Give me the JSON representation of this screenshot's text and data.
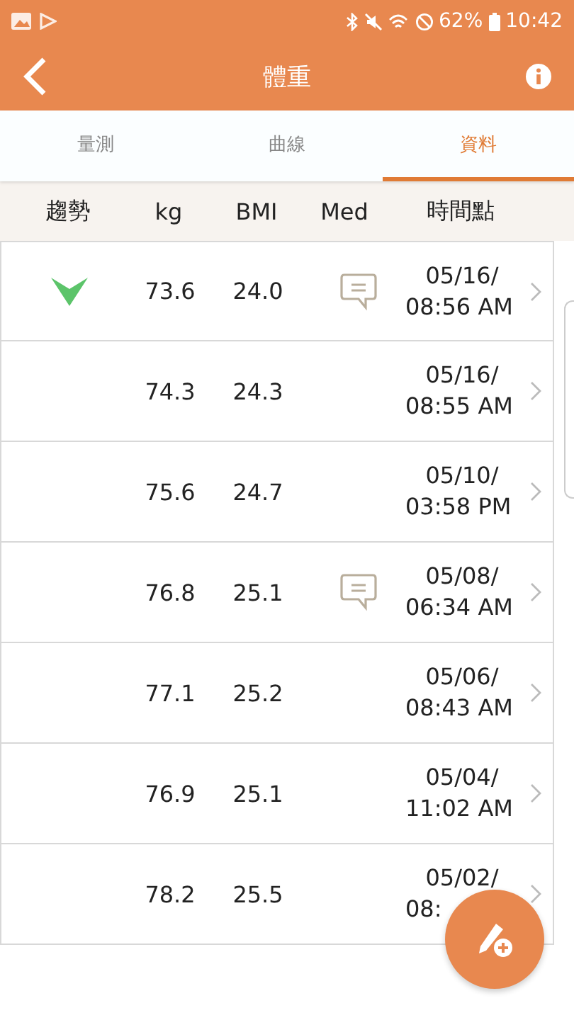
{
  "status_bar": {
    "battery": "62%",
    "time": "10:42"
  },
  "header": {
    "title": "體重"
  },
  "tabs": [
    {
      "label": "量測",
      "selected": false
    },
    {
      "label": "曲線",
      "selected": false
    },
    {
      "label": "資料",
      "selected": true
    }
  ],
  "table": {
    "columns": [
      "趨勢",
      "kg",
      "BMI",
      "Med",
      "時間點"
    ],
    "rows": [
      {
        "trending_down": true,
        "kg": "73.6",
        "bmi": "24.0",
        "note": true,
        "date": "05/16/",
        "time": "08:56 AM"
      },
      {
        "trending_down": false,
        "kg": "74.3",
        "bmi": "24.3",
        "note": false,
        "date": "05/16/",
        "time": "08:55 AM"
      },
      {
        "trending_down": false,
        "kg": "75.6",
        "bmi": "24.7",
        "note": false,
        "date": "05/10/",
        "time": "03:58 PM"
      },
      {
        "trending_down": false,
        "kg": "76.8",
        "bmi": "25.1",
        "note": true,
        "date": "05/08/",
        "time": "06:34 AM"
      },
      {
        "trending_down": false,
        "kg": "77.1",
        "bmi": "25.2",
        "note": false,
        "date": "05/06/",
        "time": "08:43 AM"
      },
      {
        "trending_down": false,
        "kg": "76.9",
        "bmi": "25.1",
        "note": false,
        "date": "05/04/",
        "time": "11:02 AM"
      },
      {
        "trending_down": false,
        "kg": "78.2",
        "bmi": "25.5",
        "note": false,
        "date": "05/02/",
        "time": "08:"
      }
    ]
  }
}
